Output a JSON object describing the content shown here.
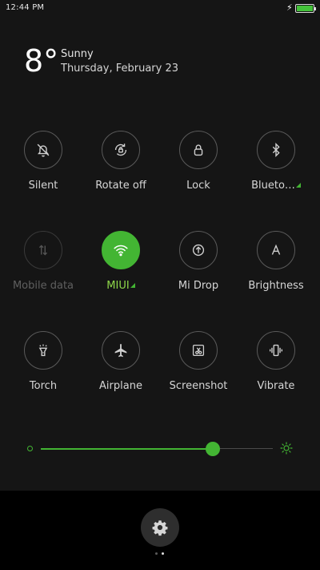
{
  "statusbar": {
    "time": "12:44 PM",
    "battery_level": 1.0
  },
  "weather": {
    "temperature": "8°",
    "condition": "Sunny",
    "date": "Thursday, February 23"
  },
  "toggles": [
    {
      "label": "Silent",
      "icon": "bell-off-icon",
      "state": "off"
    },
    {
      "label": "Rotate off",
      "icon": "rotation-lock-icon",
      "state": "off"
    },
    {
      "label": "Lock",
      "icon": "lock-icon",
      "state": "off"
    },
    {
      "label": "Blueto…",
      "icon": "bluetooth-icon",
      "state": "off",
      "expandable": true
    },
    {
      "label": "Mobile data",
      "icon": "mobile-data-icon",
      "state": "disabled"
    },
    {
      "label": "MIUI",
      "icon": "wifi-icon",
      "state": "on",
      "expandable": true
    },
    {
      "label": "Mi Drop",
      "icon": "mi-drop-icon",
      "state": "off"
    },
    {
      "label": "Brightness",
      "icon": "auto-brightness-icon",
      "state": "off"
    },
    {
      "label": "Torch",
      "icon": "torch-icon",
      "state": "off"
    },
    {
      "label": "Airplane",
      "icon": "airplane-icon",
      "state": "off"
    },
    {
      "label": "Screenshot",
      "icon": "screenshot-icon",
      "state": "off"
    },
    {
      "label": "Vibrate",
      "icon": "vibrate-icon",
      "state": "off"
    }
  ],
  "brightness": {
    "level": 0.74
  },
  "pager": {
    "pages": 2,
    "current": 2
  },
  "colors": {
    "accent": "#43b533",
    "panel": "#151515",
    "background": "#000000"
  }
}
